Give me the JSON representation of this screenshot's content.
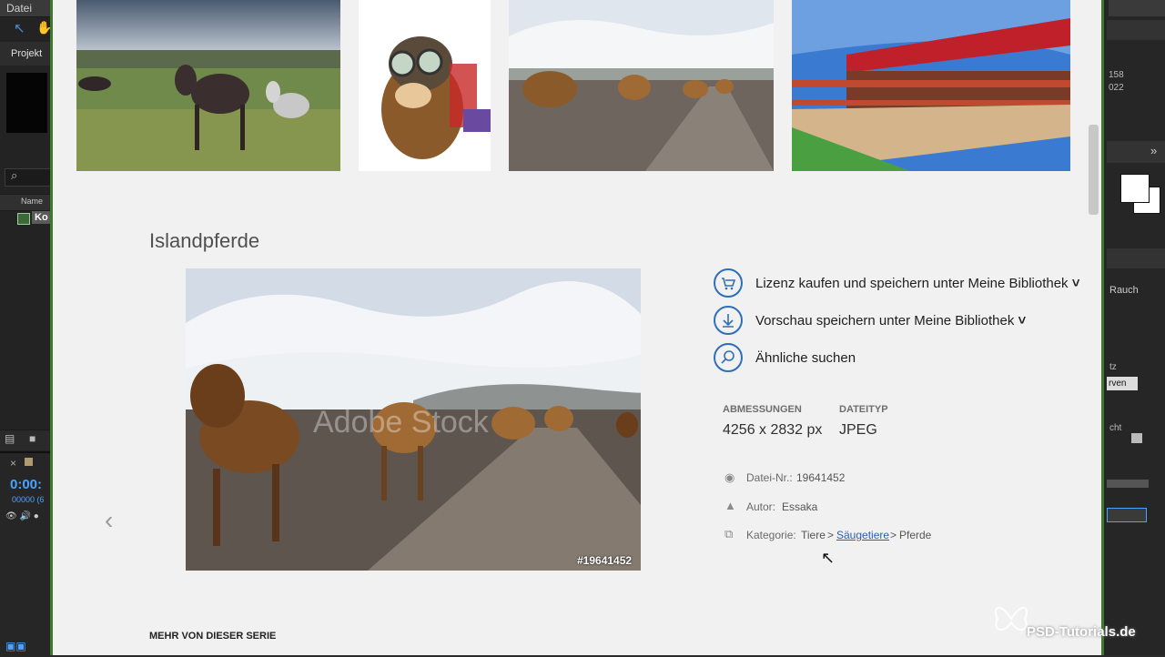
{
  "left_app": {
    "menu_datei": "Datei",
    "project_tab": "Projekt",
    "name_column": "Name",
    "composition_label": "Ko",
    "timecode": "0:00:",
    "frames": "00000 (6",
    "close_glyph": "×",
    "switches_icons": "👁 🔊 ●"
  },
  "right_app": {
    "num1": "158",
    "num2": "022",
    "effect_rauch": "Rauch",
    "effect_tz": "tz",
    "effect_kurven": "rven",
    "effect_cht": "cht"
  },
  "page": {
    "title": "Islandpferde",
    "preview_id": "#19641452",
    "actions": [
      {
        "label": "Lizenz kaufen und speichern unter Meine Bibliothek",
        "has_menu": true,
        "icon": "cart-icon"
      },
      {
        "label": "Vorschau speichern unter Meine Bibliothek",
        "has_menu": true,
        "icon": "download-icon"
      },
      {
        "label": "Ähnliche suchen",
        "has_menu": false,
        "icon": "search-icon"
      }
    ],
    "meta": {
      "dimensions_head": "ABMESSUNGEN",
      "dimensions_val": "4256 x 2832 px",
      "filetype_head": "DATEITYP",
      "filetype_val": "JPEG"
    },
    "info": {
      "file_label": "Datei-Nr.:",
      "file_val": "19641452",
      "author_label": "Autor:",
      "author_val": "Essaka",
      "category_label": "Kategorie:",
      "category_1": "Tiere",
      "category_sep": ">",
      "category_2": "Säugetiere",
      "category_3": "Pferde"
    },
    "series_heading": "MEHR VON DIESER SERIE",
    "chevron": "˅",
    "prev_arrow": "‹"
  },
  "watermark": "PSD-Tutorials.de",
  "colors": {
    "accent_blue": "#2d6fb9",
    "link_blue": "#2a5fb0",
    "frame_green": "#3e7a2e",
    "timecode_blue": "#4aa3ff"
  }
}
